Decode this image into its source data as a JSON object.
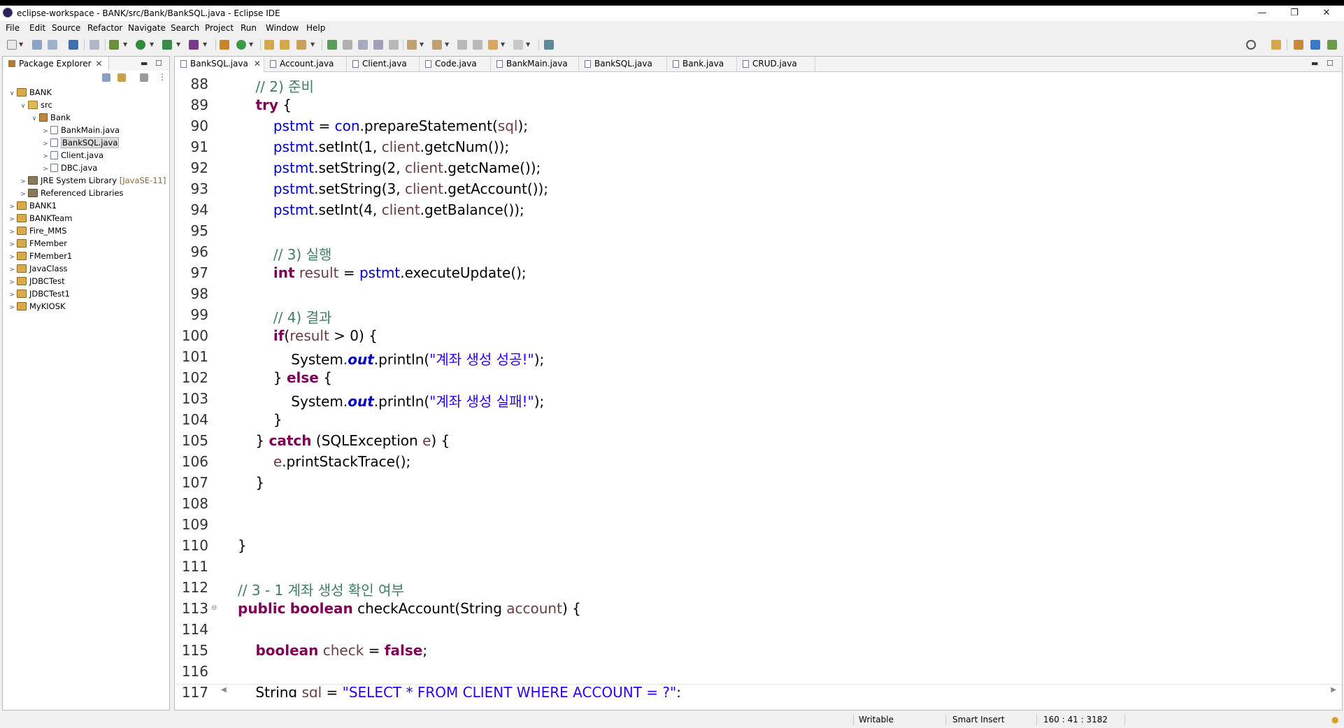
{
  "window": {
    "title": "eclipse-workspace - BANK/src/Bank/BankSQL.java - Eclipse IDE",
    "controls": [
      "—",
      "❐",
      "✕"
    ]
  },
  "menu": [
    "File",
    "Edit",
    "Source",
    "Refactor",
    "Navigate",
    "Search",
    "Project",
    "Run",
    "Window",
    "Help"
  ],
  "package_explorer": {
    "title": "Package Explorer",
    "tree": [
      {
        "label": "BANK",
        "suffix": ""
      },
      {
        "label": "src",
        "suffix": ""
      },
      {
        "label": "Bank",
        "suffix": ""
      },
      {
        "label": "BankMain.java",
        "suffix": ""
      },
      {
        "label": "BankSQL.java",
        "suffix": ""
      },
      {
        "label": "Client.java",
        "suffix": ""
      },
      {
        "label": "DBC.java",
        "suffix": ""
      },
      {
        "label": "JRE System Library",
        "suffix": "[JavaSE-11]"
      },
      {
        "label": "Referenced Libraries",
        "suffix": ""
      },
      {
        "label": "BANK1",
        "suffix": ""
      },
      {
        "label": "BANKTeam",
        "suffix": ""
      },
      {
        "label": "Fire_MMS",
        "suffix": ""
      },
      {
        "label": "FMember",
        "suffix": ""
      },
      {
        "label": "FMember1",
        "suffix": ""
      },
      {
        "label": "JavaClass",
        "suffix": ""
      },
      {
        "label": "JDBCTest",
        "suffix": ""
      },
      {
        "label": "JDBCTest1",
        "suffix": ""
      },
      {
        "label": "MyKIOSK",
        "suffix": ""
      }
    ]
  },
  "editor": {
    "tabs": [
      "BankSQL.java",
      "Account.java",
      "Client.java",
      "Code.java",
      "BankMain.java",
      "BankSQL.java",
      "Bank.java",
      "CRUD.java"
    ],
    "lines": [
      {
        "n": "88",
        "tokens": [
          {
            "t": "    "
          },
          {
            "t": "// 2) 준비",
            "c": "cm"
          }
        ]
      },
      {
        "n": "89",
        "tokens": [
          {
            "t": "    "
          },
          {
            "t": "try",
            "c": "kw"
          },
          {
            "t": " {"
          }
        ]
      },
      {
        "n": "90",
        "tokens": [
          {
            "t": "        "
          },
          {
            "t": "pstmt",
            "c": "fl"
          },
          {
            "t": " = "
          },
          {
            "t": "con",
            "c": "fl"
          },
          {
            "t": ".prepareStatement("
          },
          {
            "t": "sql",
            "c": "lv"
          },
          {
            "t": ");"
          }
        ]
      },
      {
        "n": "91",
        "tokens": [
          {
            "t": "        "
          },
          {
            "t": "pstmt",
            "c": "fl"
          },
          {
            "t": ".setInt(1, "
          },
          {
            "t": "client",
            "c": "lv"
          },
          {
            "t": ".getcNum());"
          }
        ]
      },
      {
        "n": "92",
        "tokens": [
          {
            "t": "        "
          },
          {
            "t": "pstmt",
            "c": "fl"
          },
          {
            "t": ".setString(2, "
          },
          {
            "t": "client",
            "c": "lv"
          },
          {
            "t": ".getcName());"
          }
        ]
      },
      {
        "n": "93",
        "tokens": [
          {
            "t": "        "
          },
          {
            "t": "pstmt",
            "c": "fl"
          },
          {
            "t": ".setString(3, "
          },
          {
            "t": "client",
            "c": "lv"
          },
          {
            "t": ".getAccount());"
          }
        ]
      },
      {
        "n": "94",
        "tokens": [
          {
            "t": "        "
          },
          {
            "t": "pstmt",
            "c": "fl"
          },
          {
            "t": ".setInt(4, "
          },
          {
            "t": "client",
            "c": "lv"
          },
          {
            "t": ".getBalance());"
          }
        ]
      },
      {
        "n": "95",
        "tokens": []
      },
      {
        "n": "96",
        "tokens": [
          {
            "t": "        "
          },
          {
            "t": "// 3) 실행",
            "c": "cm"
          }
        ]
      },
      {
        "n": "97",
        "tokens": [
          {
            "t": "        "
          },
          {
            "t": "int",
            "c": "kw"
          },
          {
            "t": " "
          },
          {
            "t": "result",
            "c": "lv"
          },
          {
            "t": " = "
          },
          {
            "t": "pstmt",
            "c": "fl"
          },
          {
            "t": ".executeUpdate();"
          }
        ]
      },
      {
        "n": "98",
        "tokens": []
      },
      {
        "n": "99",
        "tokens": [
          {
            "t": "        "
          },
          {
            "t": "// 4) 결과",
            "c": "cm"
          }
        ]
      },
      {
        "n": "100",
        "tokens": [
          {
            "t": "        "
          },
          {
            "t": "if",
            "c": "kw"
          },
          {
            "t": "("
          },
          {
            "t": "result",
            "c": "lv"
          },
          {
            "t": " > 0) {"
          }
        ]
      },
      {
        "n": "101",
        "tokens": [
          {
            "t": "            System."
          },
          {
            "t": "out",
            "c": "sf"
          },
          {
            "t": ".println("
          },
          {
            "t": "\"계좌 생성 성공!\"",
            "c": "st"
          },
          {
            "t": ");"
          }
        ]
      },
      {
        "n": "102",
        "tokens": [
          {
            "t": "        } "
          },
          {
            "t": "else",
            "c": "kw"
          },
          {
            "t": " {"
          }
        ]
      },
      {
        "n": "103",
        "tokens": [
          {
            "t": "            System."
          },
          {
            "t": "out",
            "c": "sf"
          },
          {
            "t": ".println("
          },
          {
            "t": "\"계좌 생성 실패!\"",
            "c": "st"
          },
          {
            "t": ");"
          }
        ]
      },
      {
        "n": "104",
        "tokens": [
          {
            "t": "        }"
          }
        ]
      },
      {
        "n": "105",
        "tokens": [
          {
            "t": "    } "
          },
          {
            "t": "catch",
            "c": "kw"
          },
          {
            "t": " (SQLException "
          },
          {
            "t": "e",
            "c": "lv"
          },
          {
            "t": ") {"
          }
        ]
      },
      {
        "n": "106",
        "tokens": [
          {
            "t": "        "
          },
          {
            "t": "e",
            "c": "lv"
          },
          {
            "t": ".printStackTrace();"
          }
        ]
      },
      {
        "n": "107",
        "tokens": [
          {
            "t": "    }"
          }
        ]
      },
      {
        "n": "108",
        "tokens": []
      },
      {
        "n": "109",
        "tokens": []
      },
      {
        "n": "110",
        "tokens": [
          {
            "t": "}"
          }
        ]
      },
      {
        "n": "111",
        "tokens": []
      },
      {
        "n": "112",
        "tokens": [
          {
            "t": "// 3 - 1 계좌 생성 확인 여부",
            "c": "cm"
          }
        ]
      },
      {
        "n": "113",
        "tokens": [
          {
            "t": "public",
            "c": "kw"
          },
          {
            "t": " "
          },
          {
            "t": "boolean",
            "c": "kw"
          },
          {
            "t": " checkAccount(String "
          },
          {
            "t": "account",
            "c": "lv"
          },
          {
            "t": ") {"
          }
        ],
        "fold": "⊖"
      },
      {
        "n": "114",
        "tokens": []
      },
      {
        "n": "115",
        "tokens": [
          {
            "t": "    "
          },
          {
            "t": "boolean",
            "c": "kw"
          },
          {
            "t": " "
          },
          {
            "t": "check",
            "c": "lv"
          },
          {
            "t": " = "
          },
          {
            "t": "false",
            "c": "kw"
          },
          {
            "t": ";"
          }
        ]
      },
      {
        "n": "116",
        "tokens": []
      },
      {
        "n": "117",
        "tokens": [
          {
            "t": "    String "
          },
          {
            "t": "sql",
            "c": "lv"
          },
          {
            "t": " = "
          },
          {
            "t": "\"SELECT * FROM CLIENT WHERE ACCOUNT = ?\"",
            "c": "st"
          },
          {
            "t": ";"
          }
        ]
      }
    ]
  },
  "status": {
    "writable": "Writable",
    "insert_mode": "Smart Insert",
    "position": "160 : 41 : 3182"
  }
}
